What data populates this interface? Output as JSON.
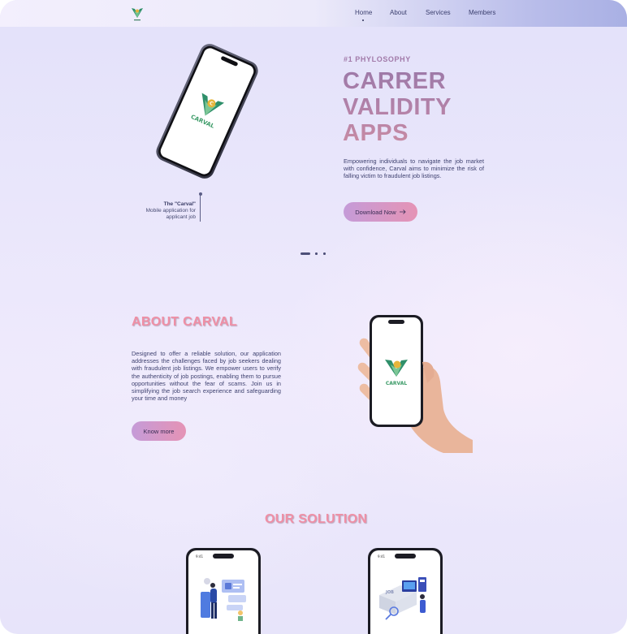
{
  "nav": {
    "logo_icon": "carval-logo-icon",
    "items": [
      {
        "label": "Home"
      },
      {
        "label": "About"
      },
      {
        "label": "Services"
      },
      {
        "label": "Members"
      }
    ]
  },
  "hero": {
    "phone_brand": "CARVAL",
    "caption_title": "The \"Carval\"",
    "caption_line1": "Mobile application for",
    "caption_line2": "applicant job",
    "eyebrow": "#1 PHYLOSOPHY",
    "title_lines": [
      "CARRER",
      "VALIDITY",
      "APPS"
    ],
    "description": "Empowering individuals to navigate the job market with confidence, Carval aims to minimize the risk of falling victim to fraudulent job listings.",
    "cta_label": "Download Now",
    "cta_icon": "arrow-right-icon"
  },
  "about": {
    "title": "ABOUT CARVAL",
    "description": "Designed to offer a reliable solution, our application addresses the challenges faced by job seekers dealing with fraudulent job listings. We empower users to verify the authenticity of job postings, enabling them to pursue opportunities without the fear of scams. Join us in simplifying the job search experience and safeguarding your time and money",
    "cta_label": "Know more",
    "phone_brand": "CARVAL"
  },
  "solution": {
    "title": "OUR SOLUTION",
    "phone_time": "9:41"
  },
  "colors": {
    "accent_pink": "#ef8fa5",
    "accent_purple": "#9c79a8",
    "button_gradient_start": "#c59bd8",
    "button_gradient_end": "#e593b5",
    "text_dark": "#3f4270"
  }
}
